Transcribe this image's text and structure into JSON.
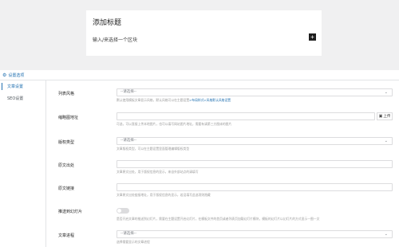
{
  "editor": {
    "title": "添加标题",
    "placeholder": "输入/来选择一个区块",
    "add_block": "+"
  },
  "settings": {
    "header": "设置选项",
    "tabs": [
      {
        "label": "文章设置"
      },
      {
        "label": "SEO设置"
      }
    ],
    "fields": {
      "list_style": {
        "label": "列表风格",
        "value": "--请选择--",
        "help_prefix": "默认使用模板文章显示风格，默认风格可以在主题设置",
        "help_link": ">布局样式>风格默认风格设置"
      },
      "thumbnail": {
        "label": "缩略图地址",
        "upload_label": "上传",
        "help": "可选，可以直接上传本地图片，也可以填写网站图片地址，需要有请第三方图床的图片"
      },
      "article_type": {
        "label": "版权类型",
        "value": "--请选择--",
        "help": "文章版权类型，可以在主题设置里面管理编辑版权类型"
      },
      "source_origin": {
        "label": "原文出处",
        "help": "文章原文出处，用于版权信息的显示，来自外部站点的请填写"
      },
      "source_link": {
        "label": "原文链接",
        "help": "文章原文出处链接地址，用于版权信息的显示，若没填写此选项则隐藏"
      },
      "recommend": {
        "label": "推送到幻灯片",
        "help": "是否开启文章的推送到幻灯片，需要在主题设置开启幻灯片，在模板文件的首页或者列表页加载幻灯片模块，模板的幻灯片以幻灯片的方式显示一图一文"
      },
      "article_tags": {
        "label": "文章进程",
        "value": "--请选择--",
        "help": "选择需要显示的文章进程"
      }
    }
  }
}
